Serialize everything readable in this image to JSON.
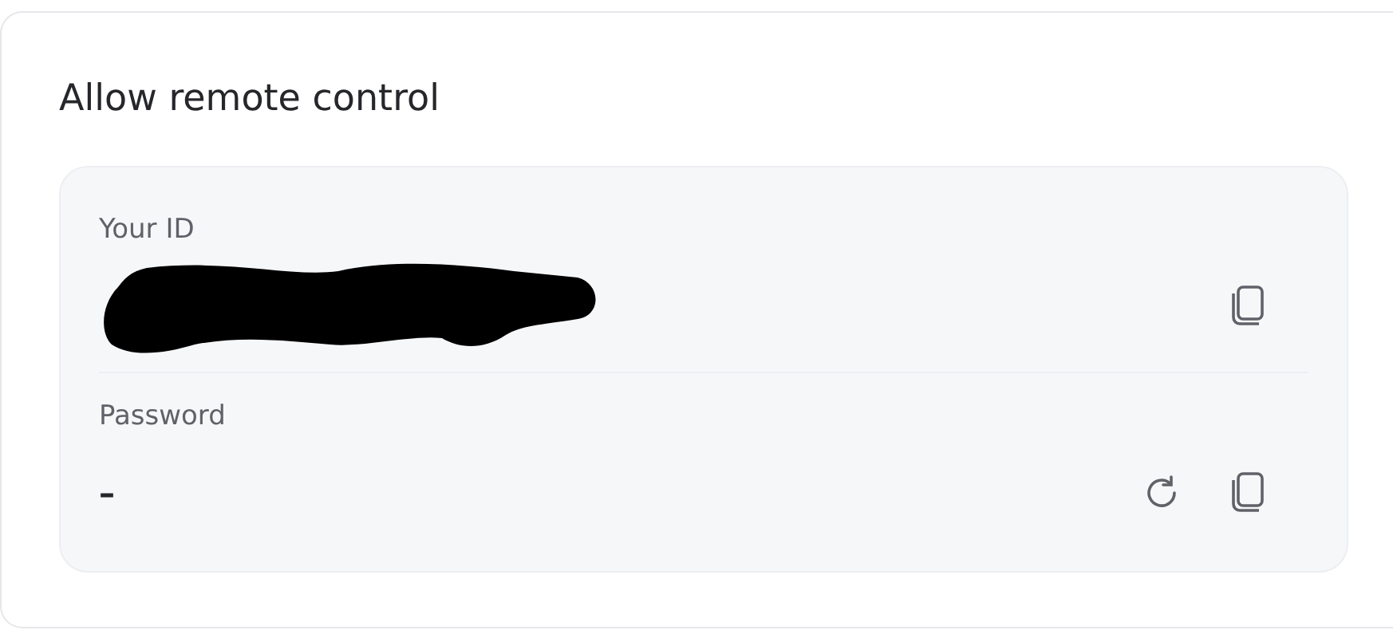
{
  "title": "Allow remote control",
  "fields": [
    {
      "label": "Your ID",
      "kind": "redacted",
      "actions": [
        {
          "kind": "copy"
        }
      ]
    },
    {
      "label": "Password",
      "kind": "text",
      "value": "–",
      "actions": [
        {
          "kind": "refresh"
        },
        {
          "kind": "copy"
        }
      ]
    }
  ]
}
